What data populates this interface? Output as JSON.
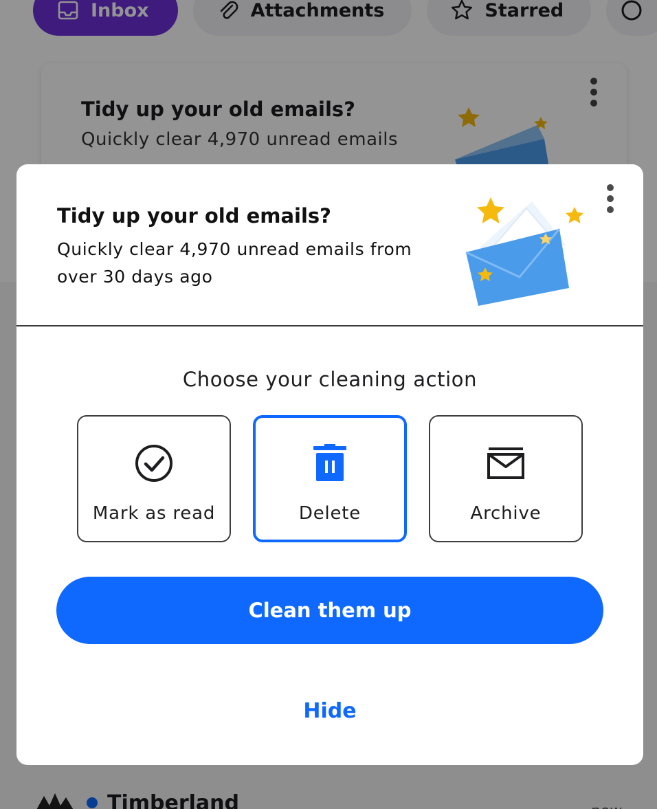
{
  "filters": {
    "inbox": "Inbox",
    "attachments": "Attachments",
    "starred": "Starred"
  },
  "background_card": {
    "title": "Tidy up your old emails?",
    "subtitle": "Quickly clear 4,970 unread emails"
  },
  "background_list": {
    "sender": "Timberland",
    "time": "now"
  },
  "modal": {
    "title": "Tidy up your old emails?",
    "subtitle": "Quickly clear 4,970 unread emails from over 30 days ago",
    "choose_label": "Choose your cleaning action",
    "actions": [
      {
        "label": "Mark as read",
        "icon": "check-circle-icon",
        "selected": false
      },
      {
        "label": "Delete",
        "icon": "trash-icon",
        "selected": true
      },
      {
        "label": "Archive",
        "icon": "archive-icon",
        "selected": false
      }
    ],
    "primary_button": "Clean them up",
    "hide_link": "Hide"
  },
  "colors": {
    "accent": "#0f69ff",
    "inbox_chip": "#6b2fd8",
    "star": "#f6b90e",
    "envelope": "#4a9bea"
  }
}
